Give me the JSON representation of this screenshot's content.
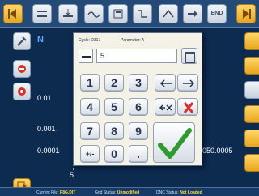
{
  "toolbar": {
    "icons": [
      "back-arrow-icon",
      "left-edge-icon",
      "profile-arrow-icon",
      "wave-icon",
      "face-icon",
      "contour-icon",
      "cut-icon",
      "arrow-icon",
      "end-icon"
    ],
    "end_label": "END"
  },
  "left_panel": {
    "icons": [
      "tool-icon",
      "graph-icon",
      "settings-icon",
      "exit-icon"
    ]
  },
  "right_panel": {
    "icons": [
      "folder-icon",
      "folder-icon",
      "print-icon",
      "edit-icon",
      "up-icon",
      "down-icon"
    ]
  },
  "plot": {
    "axis_label": "N",
    "y_ticks": [
      "0.01",
      "0.001",
      "0.0001"
    ],
    "x_right_label": "050.0005",
    "x_bottom_label": "5"
  },
  "status_bar": {
    "file_label": "Current File:",
    "file_value": "P8G.DIT",
    "grid_label": "Grid Status:",
    "grid_value": "Unmodified",
    "dnc_label": "DNC Status:",
    "dnc_value": "Not Loaded"
  },
  "dialog": {
    "cycle_label": "Cycle: D317",
    "parameter_label": "Parameter: A",
    "entry_value": "5",
    "keys": {
      "k1": "1",
      "k2": "2",
      "k3": "3",
      "k4": "4",
      "k5": "5",
      "k6": "6",
      "k7": "7",
      "k8": "8",
      "k9": "9",
      "plus_minus": "+/-",
      "zero": "0",
      "decimal": "."
    },
    "colors": {
      "clear_red": "#d8302a",
      "ok_green": "#2e9b2e"
    }
  }
}
